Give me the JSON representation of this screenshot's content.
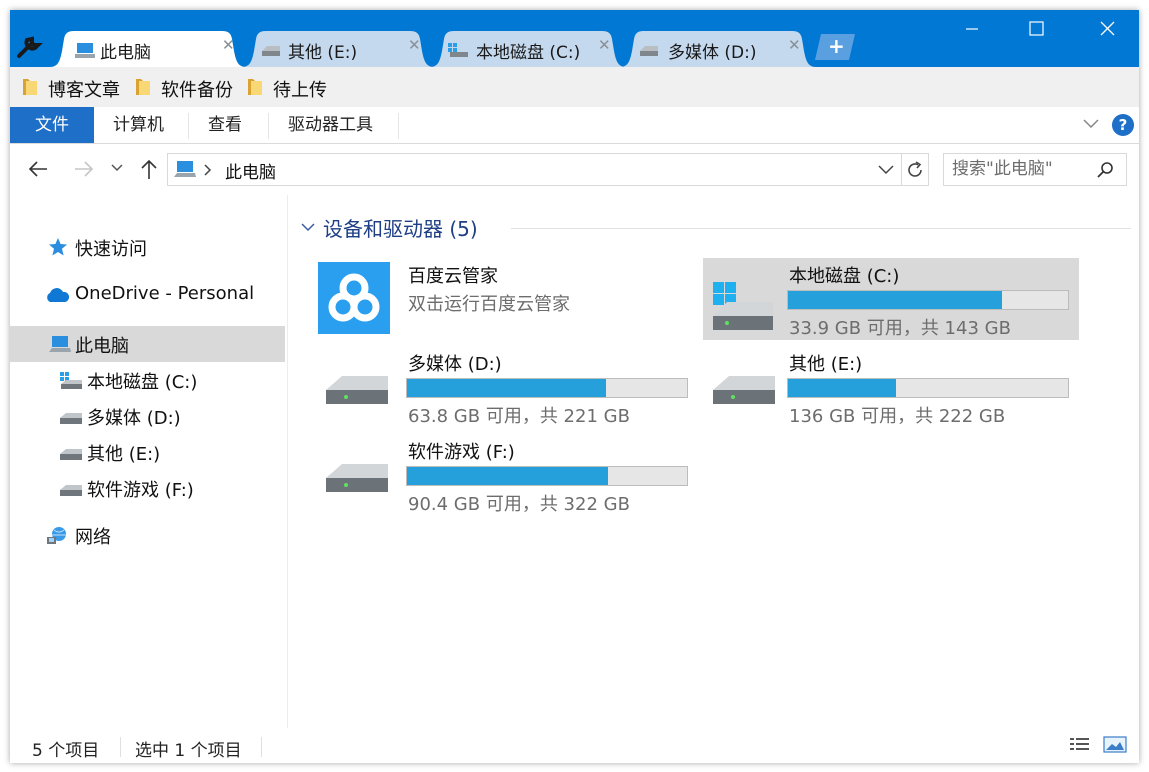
{
  "tabs": [
    {
      "label": "此电脑",
      "active": true
    },
    {
      "label": "其他 (E:)",
      "active": false
    },
    {
      "label": "本地磁盘 (C:)",
      "active": false
    },
    {
      "label": "多媒体 (D:)",
      "active": false
    }
  ],
  "new_tab_label": "+",
  "window_controls": {
    "minimize": "minimize-icon",
    "maximize": "maximize-icon",
    "close": "close-icon"
  },
  "bookmarks": [
    {
      "label": "博客文章"
    },
    {
      "label": "软件备份"
    },
    {
      "label": "待上传"
    }
  ],
  "ribbon": {
    "tabs": [
      {
        "label": "文件",
        "active": true
      },
      {
        "label": "计算机"
      },
      {
        "label": "查看"
      },
      {
        "label": "驱动器工具"
      }
    ],
    "help_label": "?"
  },
  "address": {
    "crumb": "此电脑",
    "search_placeholder": "搜索\"此电脑\""
  },
  "sidebar": {
    "quick_access": "快速访问",
    "onedrive": "OneDrive - Personal",
    "this_pc": "此电脑",
    "drives": [
      {
        "label": "本地磁盘 (C:)"
      },
      {
        "label": "多媒体 (D:)"
      },
      {
        "label": "其他 (E:)"
      },
      {
        "label": "软件游戏 (F:)"
      }
    ],
    "network": "网络"
  },
  "content": {
    "group_title": "设备和驱动器 (5)",
    "items": [
      {
        "name": "百度云管家",
        "subtitle": "双击运行百度云管家"
      },
      {
        "name": "本地磁盘 (C:)",
        "free_text": "33.9 GB 可用，共 143 GB",
        "used_fraction": 0.763,
        "selected": true
      },
      {
        "name": "多媒体 (D:)",
        "free_text": "63.8 GB 可用，共 221 GB",
        "used_fraction": 0.711
      },
      {
        "name": "其他 (E:)",
        "free_text": "136 GB 可用，共 222 GB",
        "used_fraction": 0.387
      },
      {
        "name": "软件游戏 (F:)",
        "free_text": "90.4 GB 可用，共 322 GB",
        "used_fraction": 0.719
      }
    ]
  },
  "status": {
    "count": "5 个项目",
    "selected": "选中 1 个项目"
  },
  "colors": {
    "accent": "#0078d4",
    "ribbon_active": "#1e6fc7",
    "usage_bar": "#26a0da",
    "group_header": "#1e3f86"
  }
}
